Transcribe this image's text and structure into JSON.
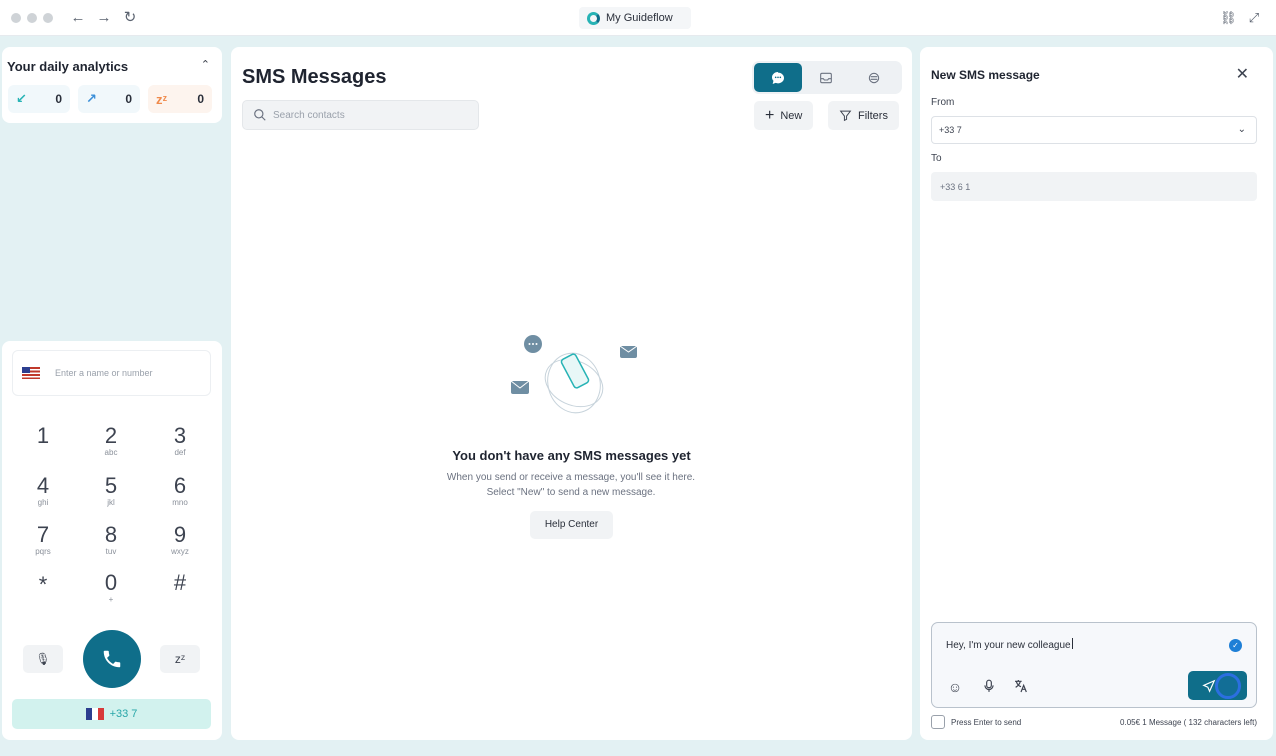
{
  "browser": {
    "title": "My Guideflow"
  },
  "analytics": {
    "title": "Your daily analytics",
    "stats": [
      {
        "icon": "incoming-call-icon",
        "value": "0",
        "color": "#27b3b5"
      },
      {
        "icon": "outgoing-call-icon",
        "value": "0",
        "color": "#3b8fd8"
      },
      {
        "icon": "snooze-icon",
        "value": "0",
        "color": "#f08a4b"
      }
    ]
  },
  "dialer": {
    "placeholder": "Enter a name or number",
    "keys": [
      {
        "digit": "1",
        "sub": ""
      },
      {
        "digit": "2",
        "sub": "abc"
      },
      {
        "digit": "3",
        "sub": "def"
      },
      {
        "digit": "4",
        "sub": "ghi"
      },
      {
        "digit": "5",
        "sub": "jkl"
      },
      {
        "digit": "6",
        "sub": "mno"
      },
      {
        "digit": "7",
        "sub": "pqrs"
      },
      {
        "digit": "8",
        "sub": "tuv"
      },
      {
        "digit": "9",
        "sub": "wxyz"
      },
      {
        "digit": "*",
        "sub": ""
      },
      {
        "digit": "0",
        "sub": "+"
      },
      {
        "digit": "#",
        "sub": ""
      }
    ],
    "snooze_label": "zᶻ",
    "number": "+33 7"
  },
  "center": {
    "title": "SMS Messages",
    "search_placeholder": "Search contacts",
    "new_label": "New",
    "filters_label": "Filters",
    "empty_title": "You don't have any SMS messages yet",
    "empty_sub": "When you send or receive a message, you'll see it here. Select \"New\" to send a new message.",
    "help_label": "Help Center"
  },
  "compose_panel": {
    "title": "New SMS message",
    "from_label": "From",
    "from_value": "+33 7",
    "to_label": "To",
    "to_value": "+33 6 1",
    "message": "Hey, I'm your new colleague",
    "press_enter_label": "Press Enter to send",
    "cost": "0.05€ 1 Message ( 132 characters left)"
  },
  "colors": {
    "brand": "#0f6e8a",
    "accent": "#27b3b5",
    "background": "#e3f1f3"
  }
}
